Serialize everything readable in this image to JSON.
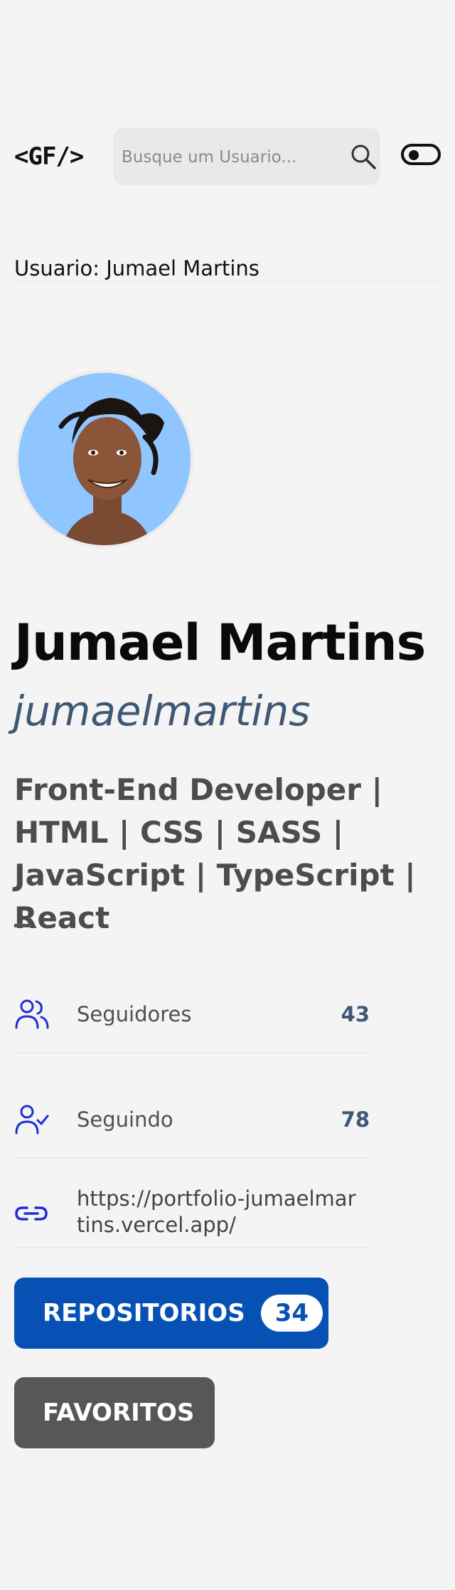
{
  "header": {
    "logo": "<GF/>",
    "search_placeholder": "Busque um Usuario...",
    "search_icon": "search-icon",
    "theme_toggle_icon": "toggle-icon"
  },
  "user_label": "Usuario: Jumael Martins",
  "profile": {
    "name": "Jumael Martins",
    "login": "jumaelmartins",
    "bio": "Front-End Developer | HTML | CSS | SASS | JavaScript | TypeScript | React",
    "avatar_alt": "avatar"
  },
  "stats": {
    "followers_label": "Seguidores",
    "followers_value": "43",
    "following_label": "Seguindo",
    "following_value": "78",
    "website": "https://portfolio-jumaelmartins.vercel.app/"
  },
  "buttons": {
    "repos_label": "REPOSITORIOS",
    "repos_count": "34",
    "favs_label": "FAVORITOS"
  },
  "colors": {
    "accent": "#0751b5",
    "secondary_button": "#575757",
    "login_text": "#3f5875",
    "icon_blue": "#1f2fd6"
  }
}
